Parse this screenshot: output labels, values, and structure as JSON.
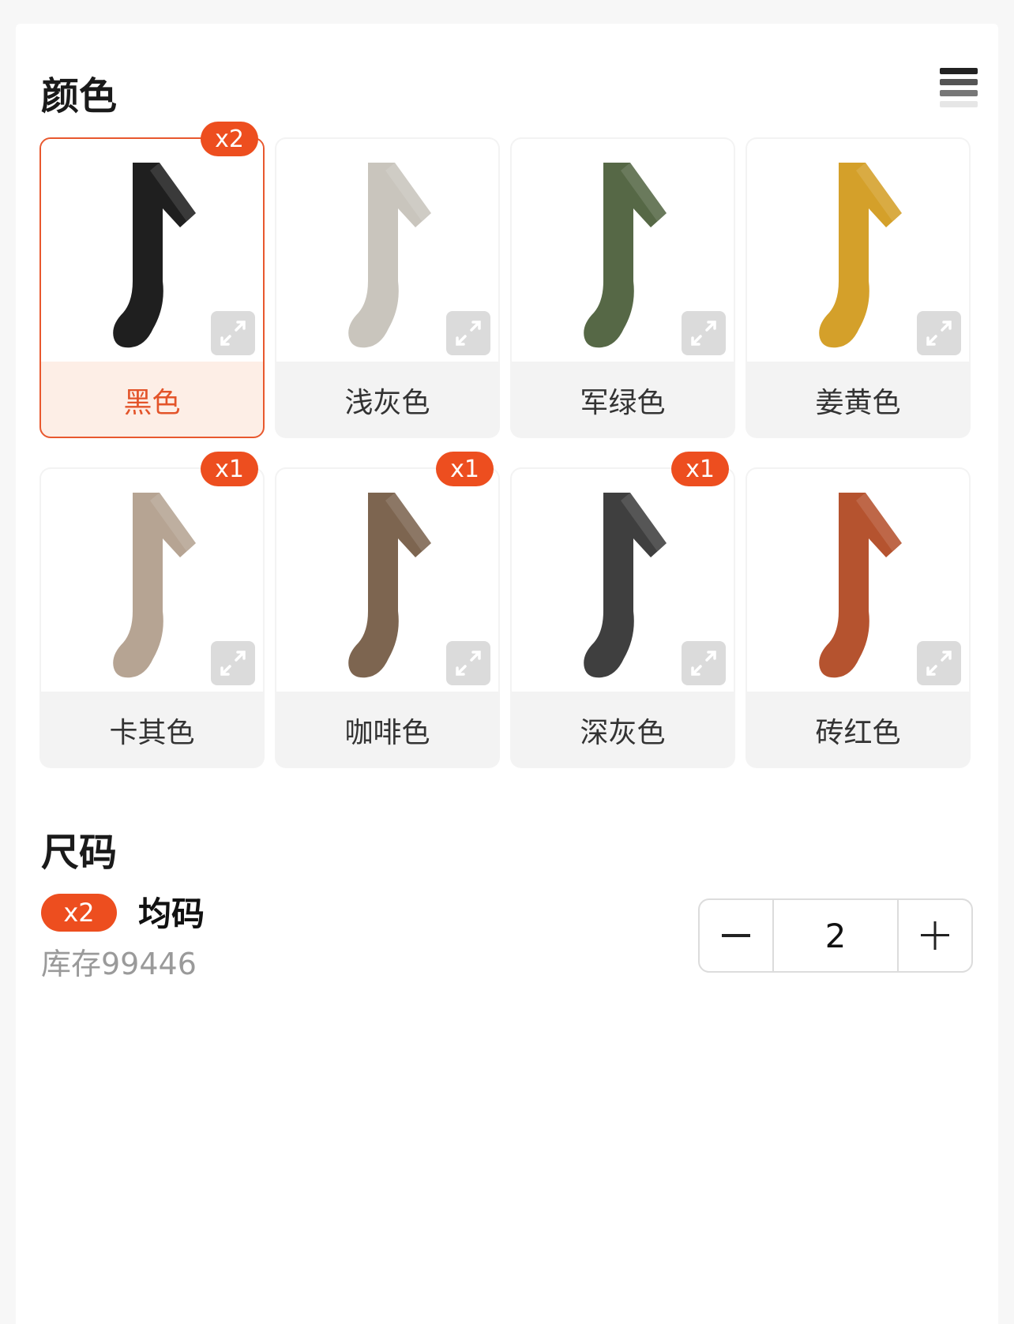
{
  "color_section": {
    "title": "颜色",
    "items": [
      {
        "label": "黑色",
        "badge": "x2",
        "color": "#1f1f1f",
        "selected": true
      },
      {
        "label": "浅灰色",
        "badge": "",
        "color": "#c9c5bd",
        "selected": false
      },
      {
        "label": "军绿色",
        "badge": "",
        "color": "#566846",
        "selected": false
      },
      {
        "label": "姜黄色",
        "badge": "",
        "color": "#d4a02a",
        "selected": false
      },
      {
        "label": "卡其色",
        "badge": "x1",
        "color": "#b6a493",
        "selected": false
      },
      {
        "label": "咖啡色",
        "badge": "x1",
        "color": "#7d6550",
        "selected": false
      },
      {
        "label": "深灰色",
        "badge": "x1",
        "color": "#3f3f3f",
        "selected": false
      },
      {
        "label": "砖红色",
        "badge": "",
        "color": "#b5532f",
        "selected": false
      }
    ]
  },
  "size_section": {
    "title": "尺码",
    "item": {
      "badge": "x2",
      "label": "均码",
      "stock": "库存99446"
    },
    "quantity": "2"
  },
  "accent_color": "#ed4e1f"
}
